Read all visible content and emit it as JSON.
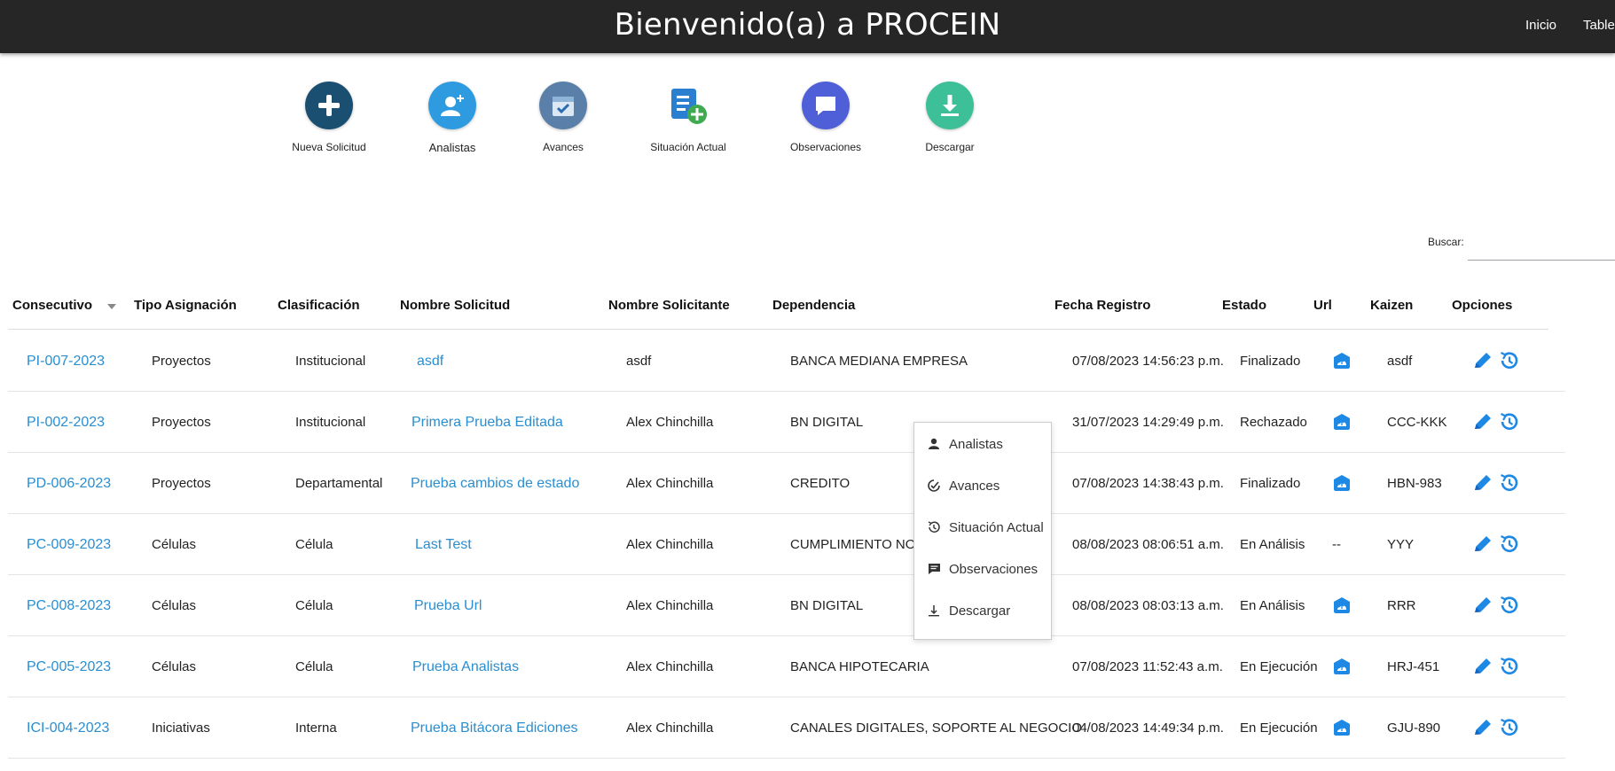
{
  "header": {
    "title": "Bienvenido(a) a PROCEIN",
    "nav": [
      "Inicio",
      "Tablero"
    ]
  },
  "actions": [
    {
      "label": "Nueva Solicitud",
      "icon": "plus-circle-icon",
      "color": "#1b4f72"
    },
    {
      "label": "Analistas",
      "icon": "add-user-icon",
      "color": "#2e9be0"
    },
    {
      "label": "Avances",
      "icon": "calendar-check-icon",
      "color": "#5a7fa8"
    },
    {
      "label": "Situación Actual",
      "icon": "clipboard-add-icon",
      "color": "#2a7fd0"
    },
    {
      "label": "Observaciones",
      "icon": "chat-bubble-icon",
      "color": "#4f5fd8"
    },
    {
      "label": "Descargar",
      "icon": "download-icon",
      "color": "#3dbf98"
    }
  ],
  "search": {
    "label": "Buscar:",
    "value": ""
  },
  "table": {
    "sort_column": "Consecutivo",
    "columns": [
      "Consecutivo",
      "Tipo Asignación",
      "Clasificación",
      "Nombre Solicitud",
      "Nombre Solicitante",
      "Dependencia",
      "Fecha Registro",
      "Estado",
      "Url",
      "Kaizen",
      "Opciones"
    ],
    "rows": [
      {
        "consecutivo": "PI-007-2023",
        "tipo": "Proyectos",
        "clasificacion": "Institucional",
        "nombre": "asdf",
        "solicitante": "asdf",
        "dependencia": "BANCA MEDIANA EMPRESA",
        "fecha": "07/08/2023 14:56:23 p.m.",
        "estado": "Finalizado",
        "url": "link",
        "kaizen": "asdf"
      },
      {
        "consecutivo": "PI-002-2023",
        "tipo": "Proyectos",
        "clasificacion": "Institucional",
        "nombre": "Primera Prueba Editada",
        "solicitante": "Alex Chinchilla",
        "dependencia": "BN DIGITAL",
        "fecha": "31/07/2023 14:29:49 p.m.",
        "estado": "Rechazado",
        "url": "link",
        "kaizen": "CCC-KKK"
      },
      {
        "consecutivo": "PD-006-2023",
        "tipo": "Proyectos",
        "clasificacion": "Departamental",
        "nombre": "Prueba cambios de estado",
        "solicitante": "Alex Chinchilla",
        "dependencia": "CREDITO",
        "fecha": "07/08/2023 14:38:43 p.m.",
        "estado": "Finalizado",
        "url": "link",
        "kaizen": "HBN-983"
      },
      {
        "consecutivo": "PC-009-2023",
        "tipo": "Células",
        "clasificacion": "Célula",
        "nombre": "Last Test",
        "solicitante": "Alex Chinchilla",
        "dependencia": "CUMPLIMIENTO NOR",
        "fecha": "08/08/2023 08:06:51 a.m.",
        "estado": "En Análisis",
        "url": "--",
        "kaizen": "YYY"
      },
      {
        "consecutivo": "PC-008-2023",
        "tipo": "Células",
        "clasificacion": "Célula",
        "nombre": "Prueba Url",
        "solicitante": "Alex Chinchilla",
        "dependencia": "BN DIGITAL",
        "fecha": "08/08/2023 08:03:13 a.m.",
        "estado": "En Análisis",
        "url": "link",
        "kaizen": "RRR"
      },
      {
        "consecutivo": "PC-005-2023",
        "tipo": "Células",
        "clasificacion": "Célula",
        "nombre": "Prueba Analistas",
        "solicitante": "Alex Chinchilla",
        "dependencia": "BANCA HIPOTECARIA",
        "fecha": "07/08/2023 11:52:43 a.m.",
        "estado": "En Ejecución",
        "url": "link",
        "kaizen": "HRJ-451"
      },
      {
        "consecutivo": "ICI-004-2023",
        "tipo": "Iniciativas",
        "clasificacion": "Interna",
        "nombre": "Prueba Bitácora Ediciones",
        "solicitante": "Alex Chinchilla",
        "dependencia": "CANALES DIGITALES, SOPORTE AL NEGOCIO",
        "fecha": "04/08/2023 14:49:34 p.m.",
        "estado": "En Ejecución",
        "url": "link",
        "kaizen": "GJU-890"
      }
    ]
  },
  "context_menu": {
    "items": [
      {
        "label": "Analistas",
        "icon": "user-icon"
      },
      {
        "label": "Avances",
        "icon": "progress-check-icon"
      },
      {
        "label": "Situación Actual",
        "icon": "history-icon"
      },
      {
        "label": "Observaciones",
        "icon": "comment-icon"
      },
      {
        "label": "Descargar",
        "icon": "download-icon"
      }
    ]
  },
  "colors": {
    "accent": "#2a8ed0",
    "topbar": "#262626",
    "icon_blue": "#1e88e5"
  }
}
